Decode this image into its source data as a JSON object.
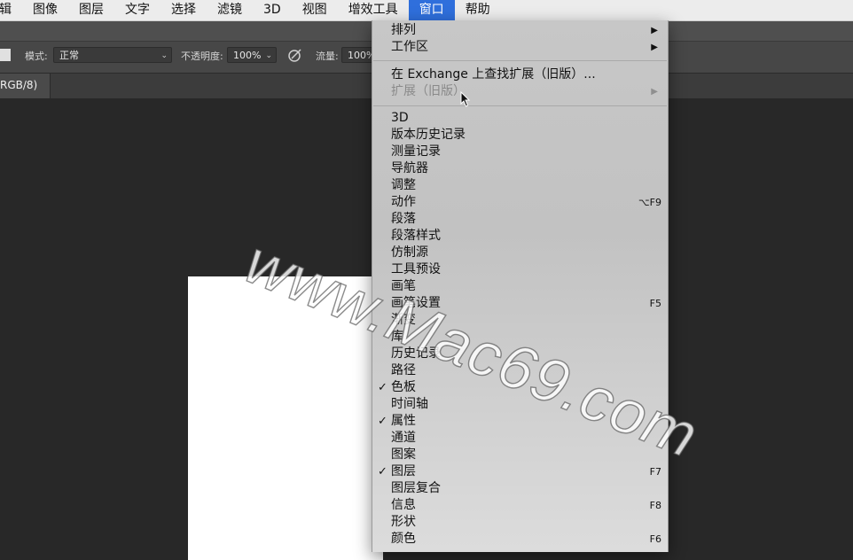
{
  "menubar": {
    "items": [
      "辑",
      "图像",
      "图层",
      "文字",
      "选择",
      "滤镜",
      "3D",
      "视图",
      "增效工具",
      "窗口",
      "帮助"
    ],
    "active": "窗口"
  },
  "options": {
    "mode_label": "模式:",
    "mode_value": "正常",
    "opacity_label": "不透明度:",
    "opacity_value": "100%",
    "flow_label": "流量:",
    "flow_value": "100%"
  },
  "document": {
    "tab_label": "RGB/8)"
  },
  "window_menu": {
    "arrange": "排列",
    "workspace": "工作区",
    "find_exchange": "在 Exchange 上查找扩展（旧版）...",
    "extensions": "扩展（旧版）",
    "panels": [
      {
        "label": "3D"
      },
      {
        "label": "版本历史记录"
      },
      {
        "label": "测量记录"
      },
      {
        "label": "导航器"
      },
      {
        "label": "调整"
      },
      {
        "label": "动作",
        "shortcut": "⌥F9"
      },
      {
        "label": "段落"
      },
      {
        "label": "段落样式"
      },
      {
        "label": "仿制源"
      },
      {
        "label": "工具预设"
      },
      {
        "label": "画笔"
      },
      {
        "label": "画笔设置",
        "shortcut": "F5"
      },
      {
        "label": "渐变"
      },
      {
        "label": "库"
      },
      {
        "label": "历史记录"
      },
      {
        "label": "路径"
      },
      {
        "label": "色板",
        "checked": true
      },
      {
        "label": "时间轴"
      },
      {
        "label": "属性",
        "checked": true
      },
      {
        "label": "通道"
      },
      {
        "label": "图案"
      },
      {
        "label": "图层",
        "checked": true,
        "shortcut": "F7"
      },
      {
        "label": "图层复合"
      },
      {
        "label": "信息",
        "shortcut": "F8"
      },
      {
        "label": "形状"
      },
      {
        "label": "颜色",
        "shortcut": "F6"
      }
    ]
  },
  "watermark": "www.Mac69.com",
  "colors": {
    "menu_highlight": "#2f6fdc",
    "app_bg": "#282828"
  }
}
